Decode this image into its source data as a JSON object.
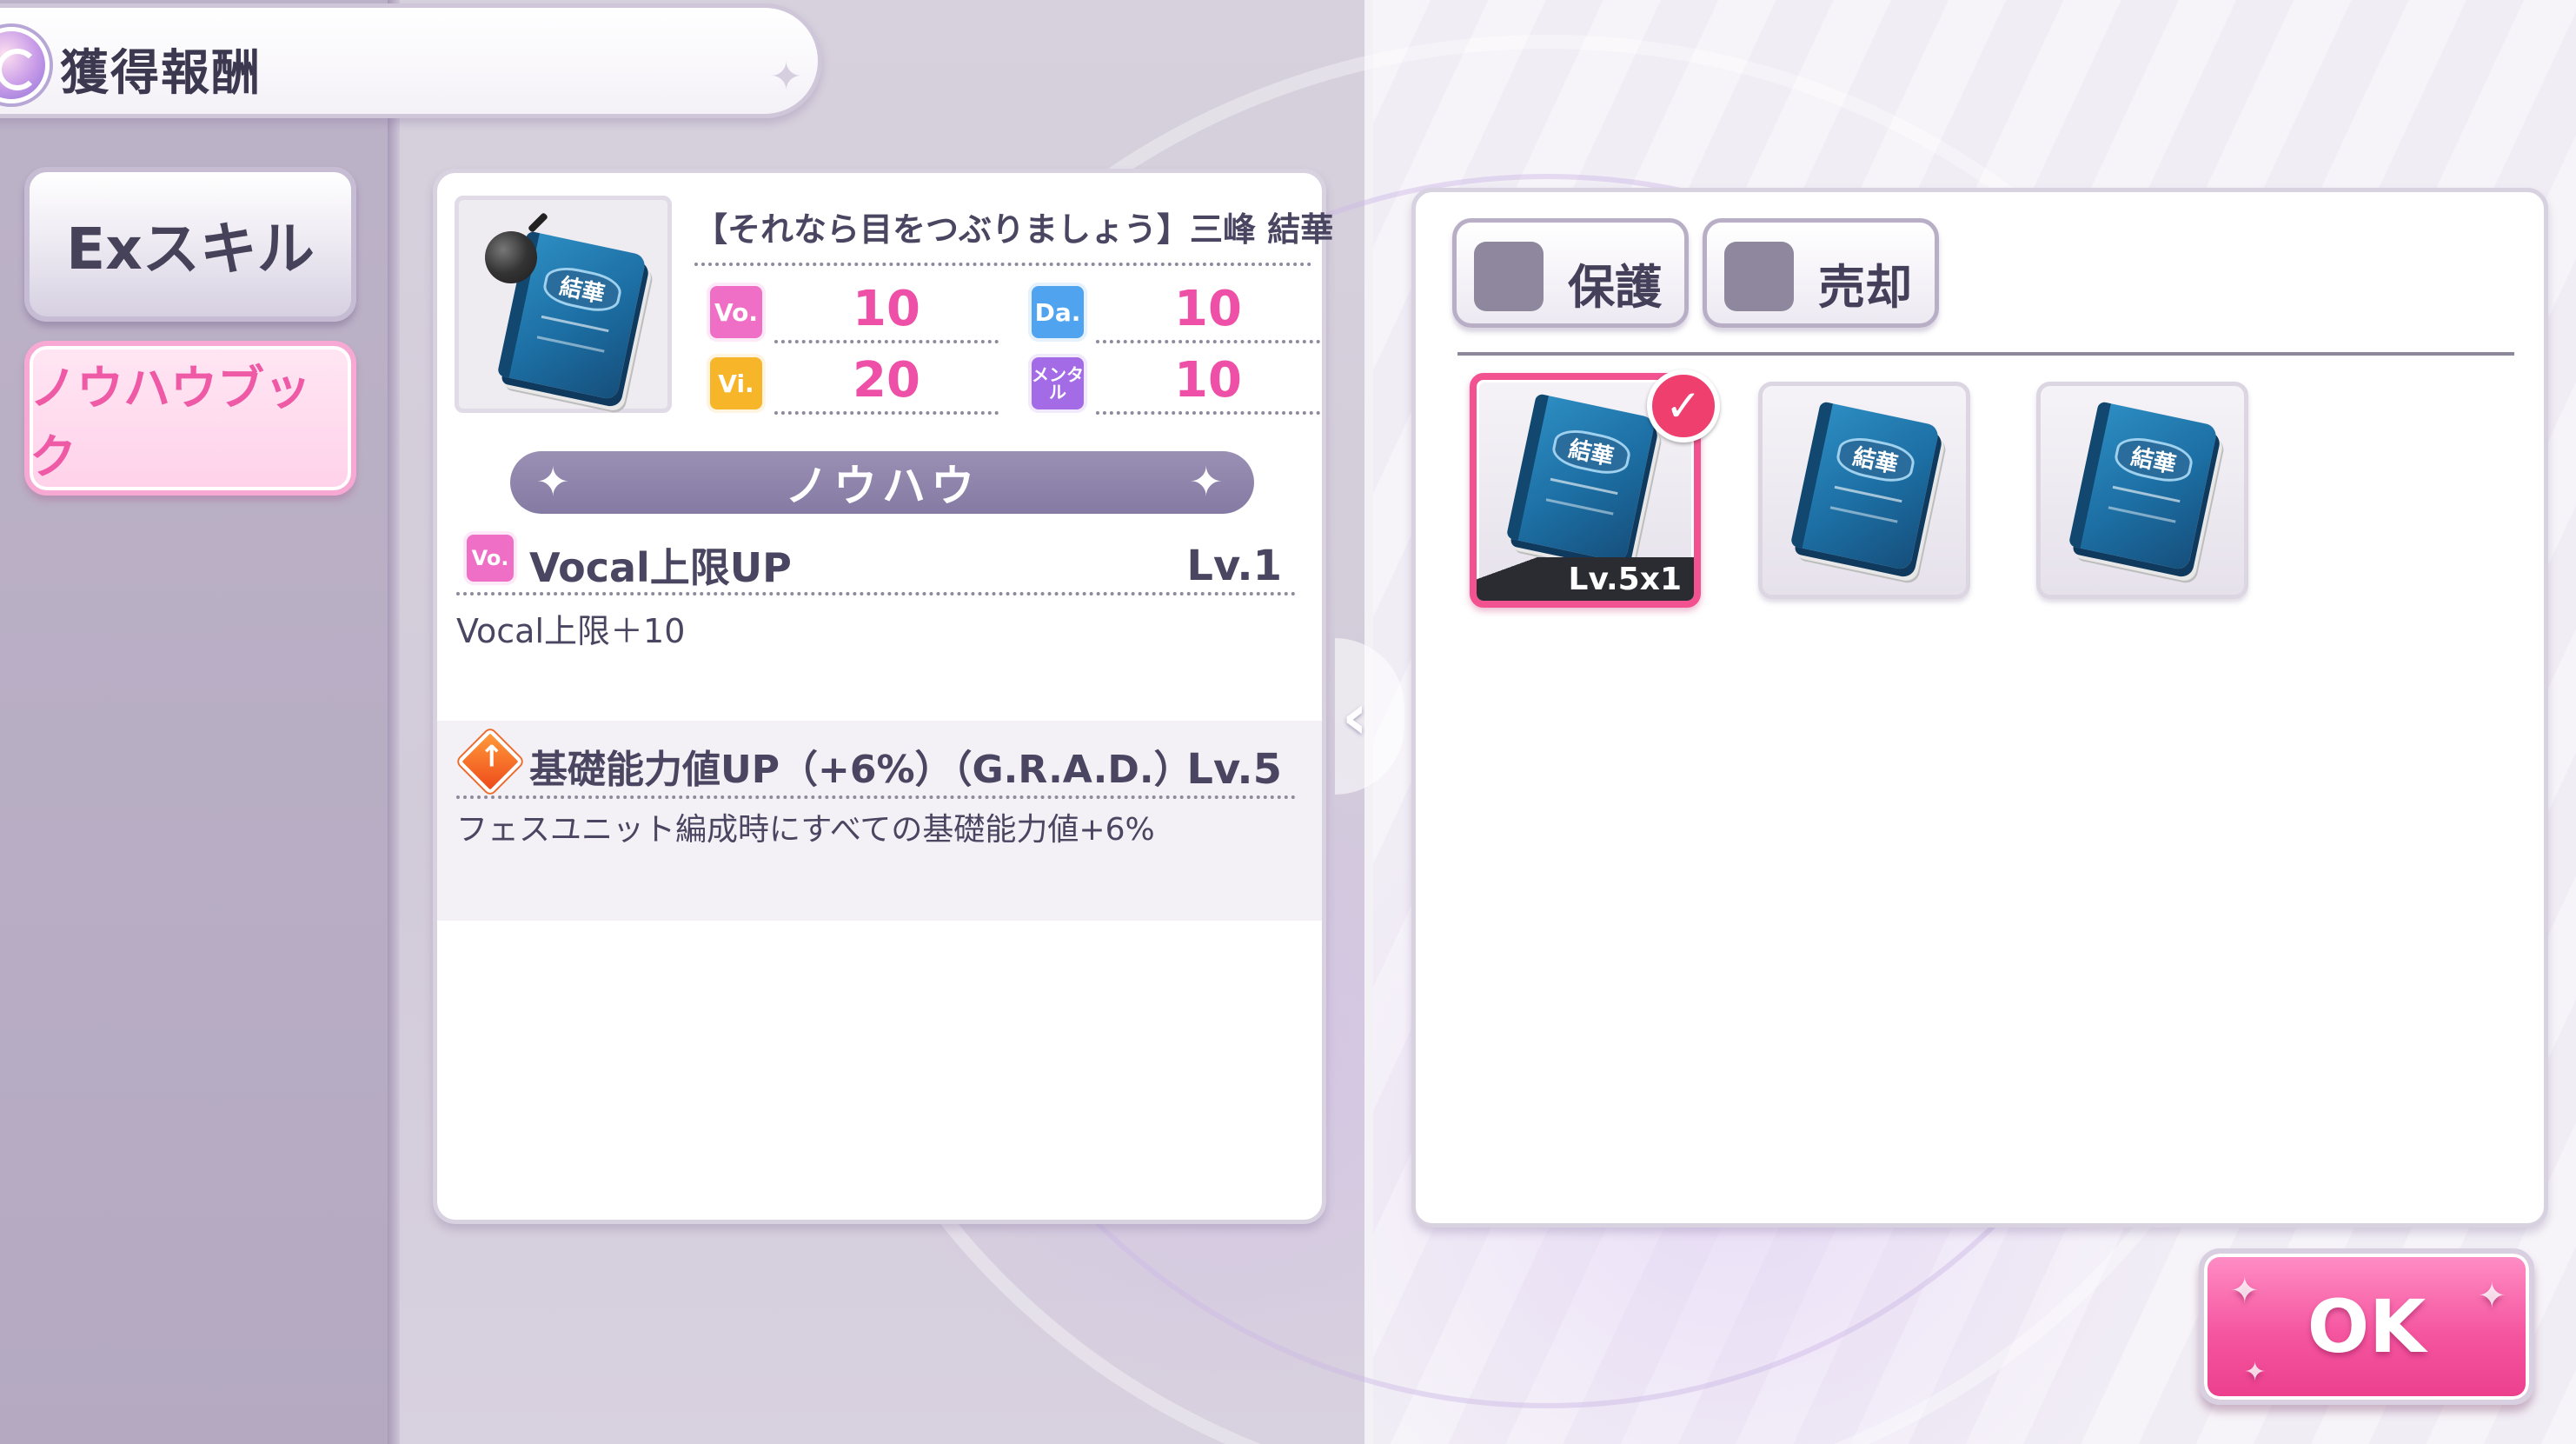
{
  "header": {
    "title": "獲得報酬",
    "icon": "spiral-emblem-icon"
  },
  "tabs": [
    {
      "label": "Exスキル",
      "active": false
    },
    {
      "label": "ノウハウブック",
      "active": true
    }
  ],
  "detail": {
    "card_title": "【それなら目をつぶりましょう】三峰 結華",
    "book_label": "結華",
    "stats": [
      {
        "badge": "Vo.",
        "value": "10",
        "color": "#f06fc6"
      },
      {
        "badge": "Da.",
        "value": "10",
        "color": "#4fa3ef"
      },
      {
        "badge": "Vi.",
        "value": "20",
        "color": "#f7b52a"
      },
      {
        "badge": "メンタル",
        "value": "10",
        "color": "#a46be6"
      }
    ],
    "section_label": "ノウハウ",
    "skills": [
      {
        "badge": "Vo.",
        "name": "Vocal上限UP",
        "level": "Lv.1",
        "description": "Vocal上限＋10"
      },
      {
        "icon": "up-arrow-diamond-icon",
        "name": "基礎能力値UP（+6%）（G.R.A.D.）",
        "level": "Lv.5",
        "description": "フェスユニット編成時にすべての基礎能力値+6%"
      }
    ]
  },
  "filters": [
    {
      "label": "保護",
      "checked": false
    },
    {
      "label": "売却",
      "checked": false
    }
  ],
  "items": [
    {
      "book_label": "結華",
      "selected": true,
      "level_text": "Lv.5x1"
    },
    {
      "book_label": "結華",
      "selected": false,
      "level_text": ""
    },
    {
      "book_label": "結華",
      "selected": false,
      "level_text": ""
    }
  ],
  "ok_button": {
    "label": "OK"
  },
  "colors": {
    "accent_pink": "#ee4fa7",
    "selected_border": "#f2528f",
    "book_blue": "#1c6ea3"
  }
}
